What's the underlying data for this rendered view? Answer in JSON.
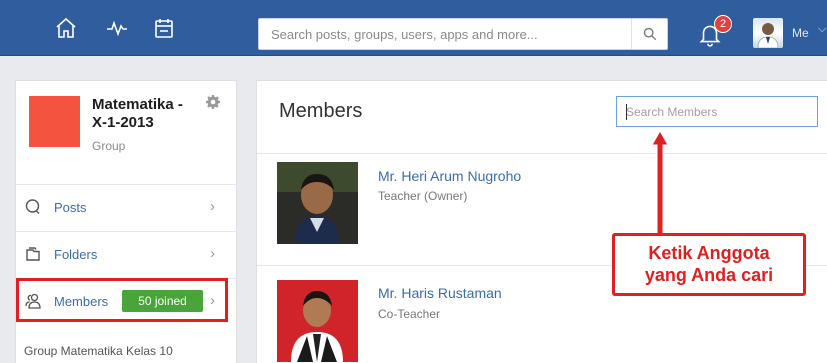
{
  "topbar": {
    "search_placeholder": "Search posts, groups, users, apps and more...",
    "notification_count": "2",
    "me_label": "Me",
    "bg_color": "#2f5d9d"
  },
  "group": {
    "name": "Matematika - X-1-2013",
    "type": "Group",
    "thumb_color": "#f4543f",
    "description": "Group Matematika Kelas 10"
  },
  "menu": {
    "posts_label": "Posts",
    "folders_label": "Folders",
    "members_label": "Members",
    "members_badge": "50 joined",
    "badge_color": "#49a43a"
  },
  "members": {
    "title": "Members",
    "search_placeholder": "Search Members",
    "list": [
      {
        "name": "Mr. Heri Arum Nugroho",
        "role": "Teacher (Owner)"
      },
      {
        "name": "Mr. Haris Rustaman",
        "role": "Co-Teacher"
      }
    ]
  },
  "annotation": {
    "text_line1": "Ketik Anggota",
    "text_line2": "yang Anda cari",
    "color": "#e0201f"
  }
}
